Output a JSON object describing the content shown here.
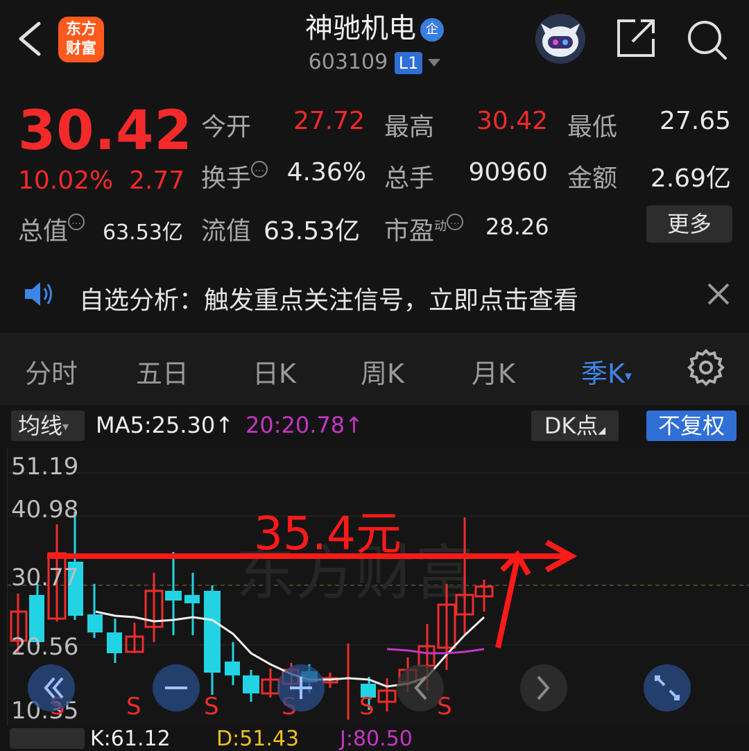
{
  "header": {
    "logo_line1": "东方",
    "logo_line2": "财富",
    "title": "神驰机电",
    "title_badge": "企",
    "code": "603109",
    "level": "L1"
  },
  "quote": {
    "price": "30.42",
    "change_pct": "10.02%",
    "change_abs": "2.77",
    "open_label": "今开",
    "open_value": "27.72",
    "high_label": "最高",
    "high_value": "30.42",
    "low_label": "最低",
    "low_value": "27.65",
    "turnover_label": "换手",
    "turnover_value": "4.36%",
    "volume_label": "总手",
    "volume_value": "90960",
    "amount_label": "金额",
    "amount_value": "2.69亿",
    "mktcap_label": "总值",
    "mktcap_value": "63.53亿",
    "float_label": "流值",
    "float_value": "63.53亿",
    "pe_label": "市盈",
    "pe_sup": "动",
    "pe_value": "28.26",
    "more_label": "更多",
    "info_icon": "…"
  },
  "alert": {
    "text": "自选分析：触发重点关注信号，立即点击查看"
  },
  "tabs": [
    {
      "label": "分时",
      "active": false
    },
    {
      "label": "五日",
      "active": false
    },
    {
      "label": "日K",
      "active": false
    },
    {
      "label": "周K",
      "active": false
    },
    {
      "label": "月K",
      "active": false
    },
    {
      "label": "季K",
      "active": true
    }
  ],
  "chart_toolbar": {
    "indicator": "均线",
    "ma5": "MA5:25.30",
    "ma20": "20:20.78",
    "dk": "DK点",
    "adjust": "不复权"
  },
  "chart": {
    "y_labels": [
      "51.19",
      "40.98",
      "30.77",
      "20.56",
      "10.35"
    ],
    "annotation": "35.4元",
    "signal_label": "S",
    "watermark": "东方财富",
    "colors": {
      "up": "#f02c2c",
      "down": "#22d3e3",
      "ma5": "#f0f0f0",
      "ma20": "#c436c4",
      "annotation": "#ff1a1a"
    }
  },
  "bottom_indicator": {
    "k": "K:61.12",
    "d": "D:51.43",
    "j": "J:80.50"
  }
}
